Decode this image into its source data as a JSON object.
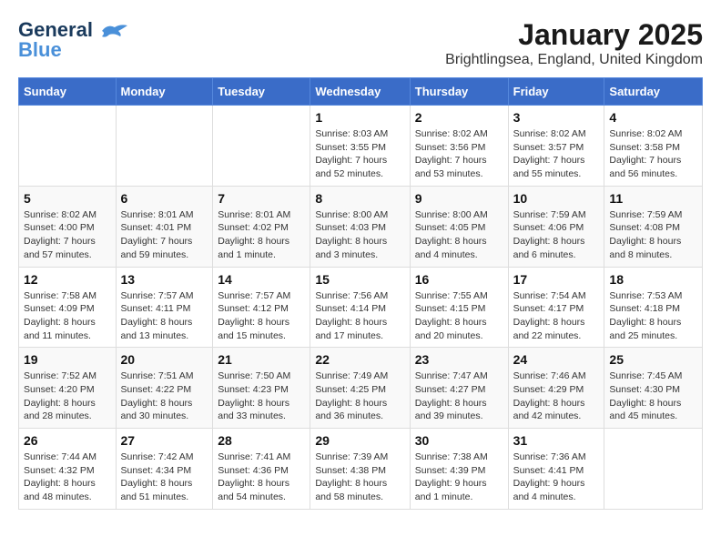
{
  "header": {
    "logo_line1": "General",
    "logo_line2": "Blue",
    "title": "January 2025",
    "subtitle": "Brightlingsea, England, United Kingdom"
  },
  "days_of_week": [
    "Sunday",
    "Monday",
    "Tuesday",
    "Wednesday",
    "Thursday",
    "Friday",
    "Saturday"
  ],
  "weeks": [
    {
      "cells": [
        {
          "day": "",
          "info": ""
        },
        {
          "day": "",
          "info": ""
        },
        {
          "day": "",
          "info": ""
        },
        {
          "day": "1",
          "info": "Sunrise: 8:03 AM\nSunset: 3:55 PM\nDaylight: 7 hours and 52 minutes."
        },
        {
          "day": "2",
          "info": "Sunrise: 8:02 AM\nSunset: 3:56 PM\nDaylight: 7 hours and 53 minutes."
        },
        {
          "day": "3",
          "info": "Sunrise: 8:02 AM\nSunset: 3:57 PM\nDaylight: 7 hours and 55 minutes."
        },
        {
          "day": "4",
          "info": "Sunrise: 8:02 AM\nSunset: 3:58 PM\nDaylight: 7 hours and 56 minutes."
        }
      ]
    },
    {
      "cells": [
        {
          "day": "5",
          "info": "Sunrise: 8:02 AM\nSunset: 4:00 PM\nDaylight: 7 hours and 57 minutes."
        },
        {
          "day": "6",
          "info": "Sunrise: 8:01 AM\nSunset: 4:01 PM\nDaylight: 7 hours and 59 minutes."
        },
        {
          "day": "7",
          "info": "Sunrise: 8:01 AM\nSunset: 4:02 PM\nDaylight: 8 hours and 1 minute."
        },
        {
          "day": "8",
          "info": "Sunrise: 8:00 AM\nSunset: 4:03 PM\nDaylight: 8 hours and 3 minutes."
        },
        {
          "day": "9",
          "info": "Sunrise: 8:00 AM\nSunset: 4:05 PM\nDaylight: 8 hours and 4 minutes."
        },
        {
          "day": "10",
          "info": "Sunrise: 7:59 AM\nSunset: 4:06 PM\nDaylight: 8 hours and 6 minutes."
        },
        {
          "day": "11",
          "info": "Sunrise: 7:59 AM\nSunset: 4:08 PM\nDaylight: 8 hours and 8 minutes."
        }
      ]
    },
    {
      "cells": [
        {
          "day": "12",
          "info": "Sunrise: 7:58 AM\nSunset: 4:09 PM\nDaylight: 8 hours and 11 minutes."
        },
        {
          "day": "13",
          "info": "Sunrise: 7:57 AM\nSunset: 4:11 PM\nDaylight: 8 hours and 13 minutes."
        },
        {
          "day": "14",
          "info": "Sunrise: 7:57 AM\nSunset: 4:12 PM\nDaylight: 8 hours and 15 minutes."
        },
        {
          "day": "15",
          "info": "Sunrise: 7:56 AM\nSunset: 4:14 PM\nDaylight: 8 hours and 17 minutes."
        },
        {
          "day": "16",
          "info": "Sunrise: 7:55 AM\nSunset: 4:15 PM\nDaylight: 8 hours and 20 minutes."
        },
        {
          "day": "17",
          "info": "Sunrise: 7:54 AM\nSunset: 4:17 PM\nDaylight: 8 hours and 22 minutes."
        },
        {
          "day": "18",
          "info": "Sunrise: 7:53 AM\nSunset: 4:18 PM\nDaylight: 8 hours and 25 minutes."
        }
      ]
    },
    {
      "cells": [
        {
          "day": "19",
          "info": "Sunrise: 7:52 AM\nSunset: 4:20 PM\nDaylight: 8 hours and 28 minutes."
        },
        {
          "day": "20",
          "info": "Sunrise: 7:51 AM\nSunset: 4:22 PM\nDaylight: 8 hours and 30 minutes."
        },
        {
          "day": "21",
          "info": "Sunrise: 7:50 AM\nSunset: 4:23 PM\nDaylight: 8 hours and 33 minutes."
        },
        {
          "day": "22",
          "info": "Sunrise: 7:49 AM\nSunset: 4:25 PM\nDaylight: 8 hours and 36 minutes."
        },
        {
          "day": "23",
          "info": "Sunrise: 7:47 AM\nSunset: 4:27 PM\nDaylight: 8 hours and 39 minutes."
        },
        {
          "day": "24",
          "info": "Sunrise: 7:46 AM\nSunset: 4:29 PM\nDaylight: 8 hours and 42 minutes."
        },
        {
          "day": "25",
          "info": "Sunrise: 7:45 AM\nSunset: 4:30 PM\nDaylight: 8 hours and 45 minutes."
        }
      ]
    },
    {
      "cells": [
        {
          "day": "26",
          "info": "Sunrise: 7:44 AM\nSunset: 4:32 PM\nDaylight: 8 hours and 48 minutes."
        },
        {
          "day": "27",
          "info": "Sunrise: 7:42 AM\nSunset: 4:34 PM\nDaylight: 8 hours and 51 minutes."
        },
        {
          "day": "28",
          "info": "Sunrise: 7:41 AM\nSunset: 4:36 PM\nDaylight: 8 hours and 54 minutes."
        },
        {
          "day": "29",
          "info": "Sunrise: 7:39 AM\nSunset: 4:38 PM\nDaylight: 8 hours and 58 minutes."
        },
        {
          "day": "30",
          "info": "Sunrise: 7:38 AM\nSunset: 4:39 PM\nDaylight: 9 hours and 1 minute."
        },
        {
          "day": "31",
          "info": "Sunrise: 7:36 AM\nSunset: 4:41 PM\nDaylight: 9 hours and 4 minutes."
        },
        {
          "day": "",
          "info": ""
        }
      ]
    }
  ]
}
